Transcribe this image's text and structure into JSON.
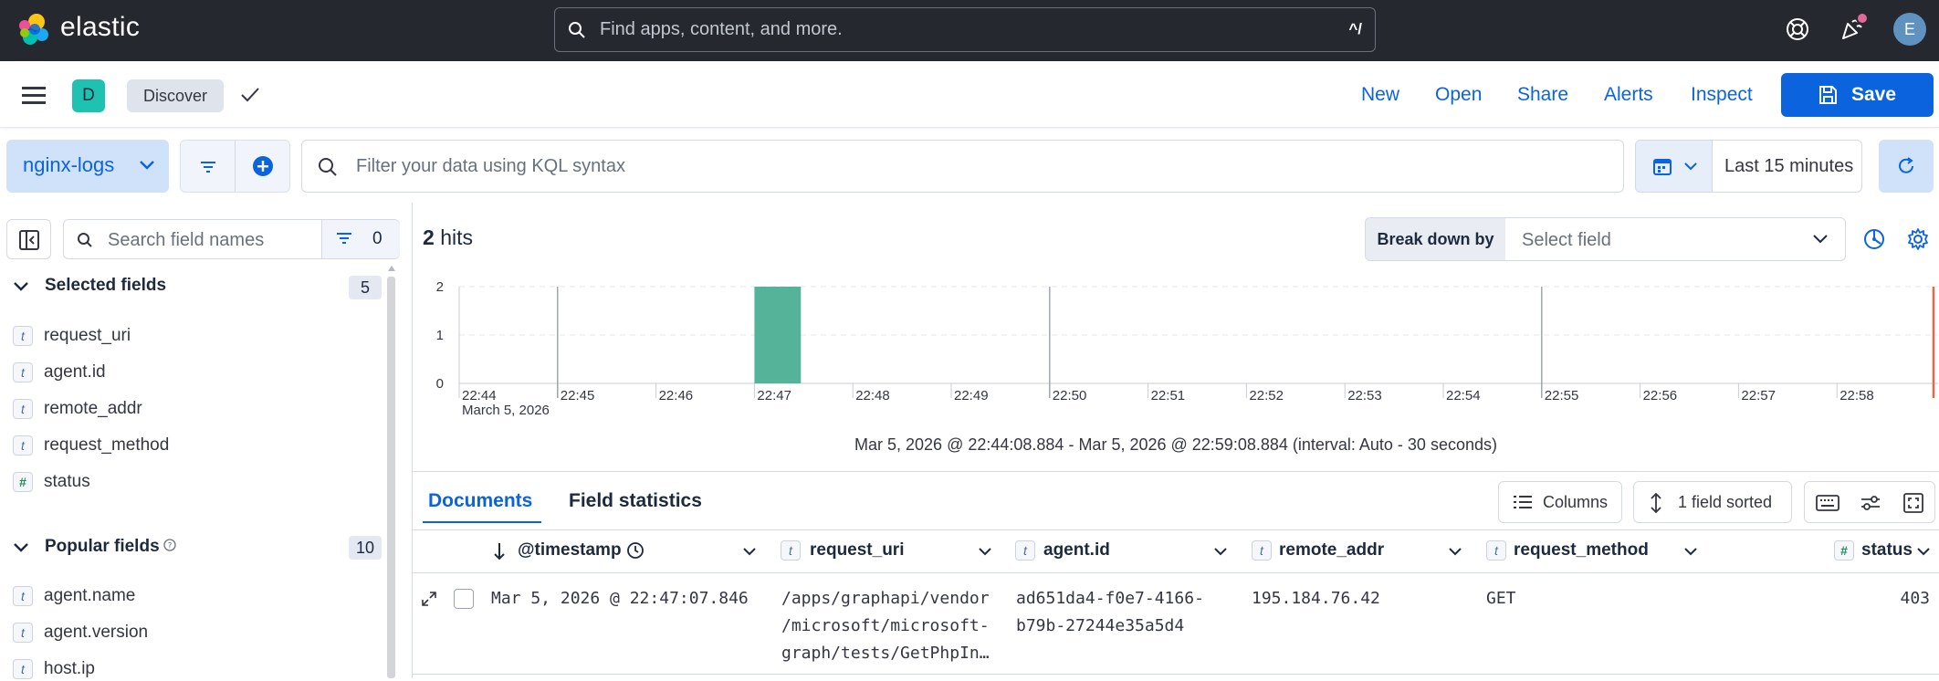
{
  "brand": {
    "name": "elastic"
  },
  "global_search": {
    "placeholder": "Find apps, content, and more.",
    "shortcut": "^/"
  },
  "user": {
    "initial": "E"
  },
  "app_header": {
    "space_initial": "D",
    "breadcrumb": "Discover",
    "nav": {
      "new": "New",
      "open": "Open",
      "share": "Share",
      "alerts": "Alerts",
      "inspect": "Inspect"
    },
    "save_label": "Save"
  },
  "query_bar": {
    "data_view": "nginx-logs",
    "placeholder": "Filter your data using KQL syntax",
    "time_range": "Last 15 minutes"
  },
  "sidebar": {
    "search_placeholder": "Search field names",
    "filter_count": "0",
    "selected": {
      "title": "Selected fields",
      "count": "5",
      "fields": [
        {
          "type": "t",
          "name": "request_uri"
        },
        {
          "type": "t",
          "name": "agent.id"
        },
        {
          "type": "t",
          "name": "remote_addr"
        },
        {
          "type": "t",
          "name": "request_method"
        },
        {
          "type": "#",
          "name": "status"
        }
      ]
    },
    "popular": {
      "title": "Popular fields",
      "count": "10",
      "fields": [
        {
          "type": "t",
          "name": "agent.name"
        },
        {
          "type": "t",
          "name": "agent.version"
        },
        {
          "type": "t",
          "name": "host.ip"
        }
      ]
    }
  },
  "hits": {
    "count": "2",
    "label": "hits"
  },
  "breakdown": {
    "label": "Break down by",
    "placeholder": "Select field"
  },
  "chart_data": {
    "type": "bar",
    "y_ticks": [
      "2",
      "1",
      "0"
    ],
    "ylim": [
      0,
      2
    ],
    "x_ticks": [
      "22:44",
      "22:45",
      "22:46",
      "22:47",
      "22:48",
      "22:49",
      "22:50",
      "22:51",
      "22:52",
      "22:53",
      "22:54",
      "22:55",
      "22:56",
      "22:57",
      "22:58"
    ],
    "x_sublabel": "March 5, 2026",
    "bars": [
      {
        "x": "22:47:00",
        "y": 2
      }
    ],
    "bar_color": "#54b399",
    "range_text": "Mar 5, 2026 @ 22:44:08.884 - Mar 5, 2026 @ 22:59:08.884 (interval: Auto - 30 seconds)"
  },
  "tabs": {
    "documents": "Documents",
    "field_statistics": "Field statistics"
  },
  "grid_toolbar": {
    "columns": "Columns",
    "sorted": "1 field sorted"
  },
  "table": {
    "columns": {
      "timestamp": "@timestamp",
      "request_uri": "request_uri",
      "agent_id": "agent.id",
      "remote_addr": "remote_addr",
      "request_method": "request_method",
      "status": "status"
    },
    "rows": [
      {
        "timestamp": "Mar 5, 2026 @ 22:47:07.846",
        "request_uri_lines": [
          "/apps/graphapi/vendor",
          "/microsoft/microsoft-",
          "graph/tests/GetPhpIn…"
        ],
        "agent_id_lines": [
          "ad651da4-f0e7-4166-",
          "b79b-27244e35a5d4"
        ],
        "remote_addr": "195.184.76.42",
        "request_method": "GET",
        "status": "403"
      }
    ]
  },
  "colors": {
    "accent": "#0b64dd",
    "topbar": "#25282f",
    "bar": "#54b399",
    "space": "#1fc1b1"
  }
}
